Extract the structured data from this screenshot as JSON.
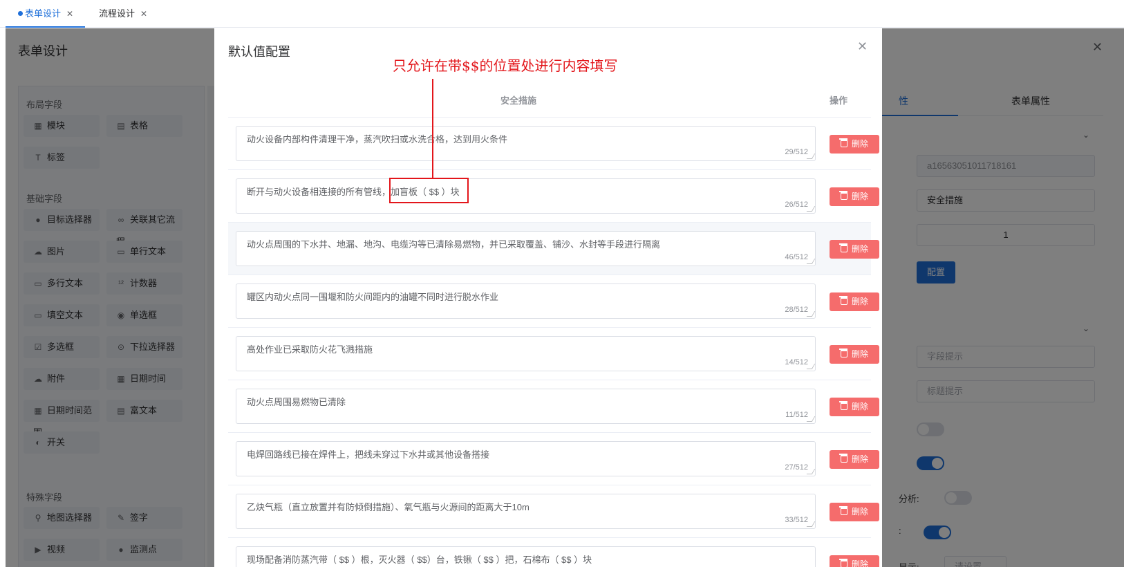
{
  "tabs": [
    {
      "label": "表单设计",
      "active": true
    },
    {
      "label": "流程设计",
      "active": false
    }
  ],
  "background": {
    "title": "表单设计",
    "groups": [
      {
        "title": "布局字段",
        "items": [
          {
            "label": "模块",
            "icon": "module-icon"
          },
          {
            "label": "表格",
            "icon": "table-icon"
          },
          {
            "label": "标签",
            "icon": "text-label-icon"
          }
        ]
      },
      {
        "title": "基础字段",
        "items": [
          {
            "label": "目标选择器",
            "icon": "user-icon"
          },
          {
            "label": "关联其它流程",
            "icon": "link-icon"
          },
          {
            "label": "图片",
            "icon": "image-icon"
          },
          {
            "label": "单行文本",
            "icon": "input-icon"
          },
          {
            "label": "多行文本",
            "icon": "textarea-icon"
          },
          {
            "label": "计数器",
            "icon": "number-icon"
          },
          {
            "label": "填空文本",
            "icon": "blank-text-icon"
          },
          {
            "label": "单选框",
            "icon": "radio-icon"
          },
          {
            "label": "多选框",
            "icon": "checkbox-icon"
          },
          {
            "label": "下拉选择器",
            "icon": "select-icon"
          },
          {
            "label": "附件",
            "icon": "attachment-icon"
          },
          {
            "label": "日期时间",
            "icon": "calendar-icon"
          },
          {
            "label": "日期时间范围",
            "icon": "date-range-icon"
          },
          {
            "label": "富文本",
            "icon": "rich-text-icon"
          },
          {
            "label": "开关",
            "icon": "switch-icon"
          }
        ]
      },
      {
        "title": "特殊字段",
        "items": [
          {
            "label": "地图选择器",
            "icon": "map-pin-icon"
          },
          {
            "label": "签字",
            "icon": "signature-icon"
          },
          {
            "label": "视频",
            "icon": "video-icon"
          },
          {
            "label": "监测点",
            "icon": "monitor-point-icon"
          }
        ]
      }
    ],
    "right_panel": {
      "tab_field_attr": "性",
      "tab_form_attr": "表单属性",
      "field_id": "a16563051011718161",
      "field_title": "安全措施",
      "number_value": "1",
      "config_button": "配置",
      "placeholder_field_hint": "字段提示",
      "placeholder_title_hint": "标题提示",
      "label_analysis": "分析:",
      "label_colon": ":",
      "label_display": "显示:",
      "select_placeholder": "请设置"
    }
  },
  "dialog": {
    "title": "默认值配置",
    "annotation": "只允许在带$$的位置处进行内容填写",
    "columns": {
      "measure": "安全措施",
      "action": "操作"
    },
    "delete_label": "删除",
    "rows": [
      {
        "text": "动火设备内部构件清理干净，蒸汽吹扫或水洗合格，达到用火条件",
        "count": "29/512"
      },
      {
        "text": "断开与动火设备相连接的所有管线，加盲板（ $$ ）块",
        "count": "26/512"
      },
      {
        "text": "动火点周围的下水井、地漏、地沟、电缆沟等已清除易燃物，并已采取覆盖、铺沙、水封等手段进行隔离",
        "count": "46/512"
      },
      {
        "text": "罐区内动火点同一围堰和防火间距内的油罐不同时进行脱水作业",
        "count": "28/512"
      },
      {
        "text": "高处作业已采取防火花飞溅措施",
        "count": "14/512"
      },
      {
        "text": "动火点周围易燃物已清除",
        "count": "11/512"
      },
      {
        "text": "电焊回路线已接在焊件上，把线未穿过下水井或其他设备搭接",
        "count": "27/512"
      },
      {
        "text": "乙炔气瓶（直立放置并有防倾倒措施）、氧气瓶与火源间的距离大于10m",
        "count": "33/512"
      },
      {
        "text": "现场配备消防蒸汽带（ $$ ）根，灭火器（ $$）台，铁锹（ $$ ）把，石棉布（ $$ ）块",
        "count": ""
      }
    ]
  }
}
